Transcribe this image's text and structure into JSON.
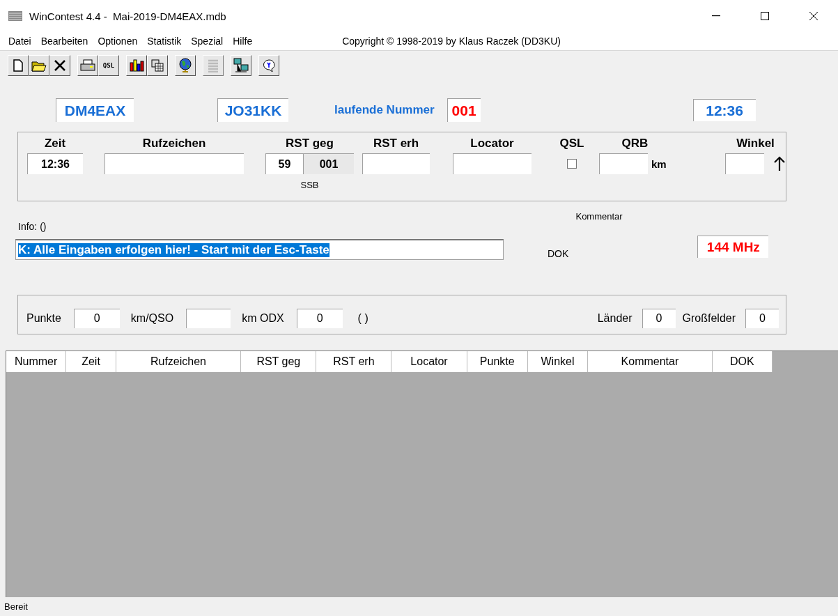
{
  "window": {
    "title": "WinContest 4.4 -  Mai-2019-DM4EAX.mdb"
  },
  "menu": [
    "Datei",
    "Bearbeiten",
    "Optionen",
    "Statistik",
    "Spezial",
    "Hilfe"
  ],
  "copyright": "Copyright © 1998-2019 by Klaus Raczek (DD3KU)",
  "toolbar": [
    [
      {
        "kind": "new"
      },
      {
        "kind": "open"
      },
      {
        "kind": "delete"
      }
    ],
    [
      {
        "kind": "print"
      },
      {
        "kind": "text",
        "label": "QSL"
      }
    ],
    [
      {
        "kind": "chart"
      },
      {
        "kind": "copy"
      }
    ],
    [
      {
        "kind": "globe"
      }
    ],
    [
      {
        "kind": "list",
        "disabled": true
      }
    ],
    [
      {
        "kind": "network"
      }
    ],
    [
      {
        "kind": "help"
      }
    ]
  ],
  "header": {
    "callsign": "DM4EAX",
    "locator": "JO31KK",
    "serial_label": "laufende Nummer",
    "serial": "001",
    "clock": "12:36"
  },
  "entry": {
    "columns": [
      {
        "kind": "text",
        "label": "Zeit",
        "value": "12:36"
      },
      {
        "kind": "text",
        "label": "Rufzeichen"
      },
      {
        "kind": "rst",
        "label": "RST geg",
        "value": "59",
        "serial": "001",
        "mode": "SSB"
      },
      {
        "kind": "text",
        "label": "RST erh"
      },
      {
        "kind": "text",
        "label": "Locator"
      },
      {
        "kind": "checkbox",
        "label": "QSL",
        "checked": false
      },
      {
        "kind": "unit",
        "label": "QRB",
        "unit": "km"
      },
      {
        "kind": "angle",
        "label": "Winkel"
      }
    ]
  },
  "info_label": "Info: ()",
  "comment_label": "Kommentar",
  "command": {
    "value": "K: Alle Eingaben erfolgen hier! - Start mit der Esc-Taste",
    "selected": true
  },
  "dok_label": "DOK",
  "band": "144 MHz",
  "stats": [
    {
      "label": "Punkte",
      "value": "0"
    },
    {
      "label": "km/QSO"
    },
    {
      "label": "km ODX",
      "value": "0"
    },
    {
      "kind": "note",
      "label": "( )"
    },
    {
      "kind": "spacer"
    },
    {
      "label": "Länder",
      "value": "0"
    },
    {
      "label": "Großfelder",
      "value": "0"
    }
  ],
  "table": {
    "columns": [
      "Nummer",
      "Zeit",
      "Rufzeichen",
      "RST geg",
      "RST erh",
      "Locator",
      "Punkte",
      "Winkel",
      "Kommentar",
      "DOK"
    ]
  },
  "status_bar": "Bereit"
}
